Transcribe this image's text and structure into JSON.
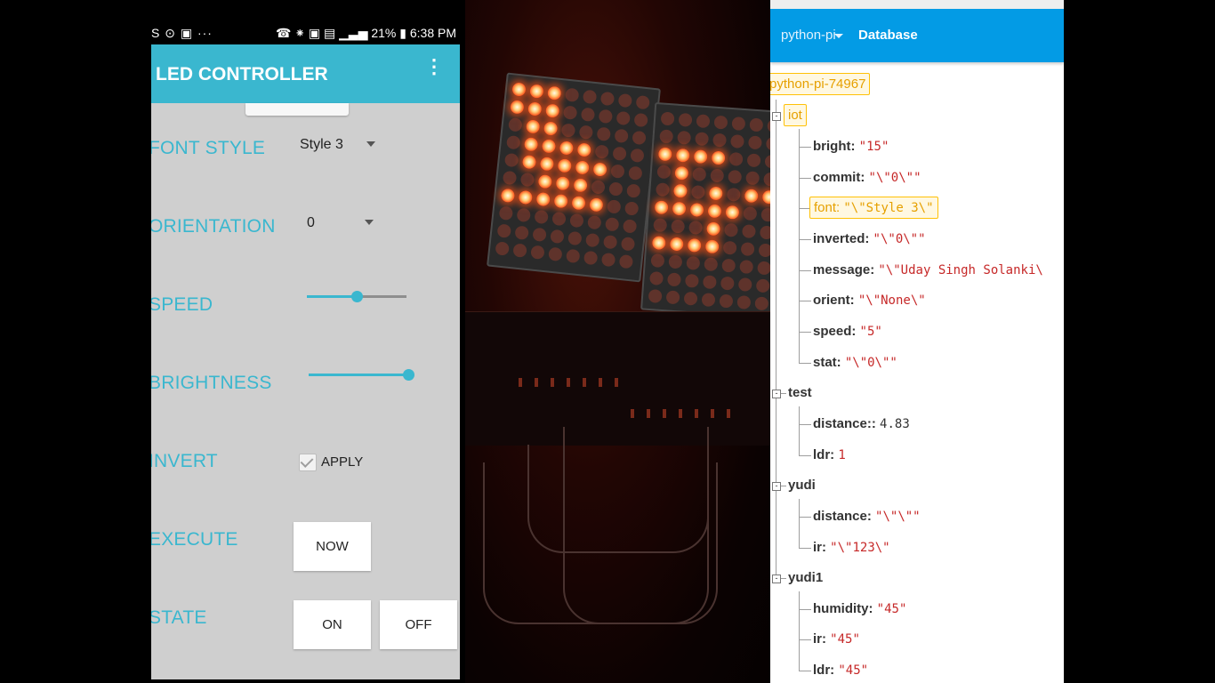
{
  "phone": {
    "status": {
      "left": "S ⊙ ▣  ···",
      "right": "☎ ⁕ ▣ ▤ ▁▃▅ 21% ▮ 6:38 PM"
    },
    "app_title": "LED CONTROLLER",
    "menu_icon": "⋮",
    "rows": {
      "font_label": "FONT STYLE",
      "font_value": "Style 3",
      "orientation_label": "ORIENTATION",
      "orientation_value": "0",
      "speed_label": "SPEED",
      "speed_level": 0.5,
      "brightness_label": "BRIGHTNESS",
      "brightness_level": 1.0,
      "invert_label": "INVERT",
      "apply_label": "APPLY",
      "apply_checked": true,
      "execute_label": "EXECUTE",
      "now_button": "NOW",
      "state_label": "STATE",
      "on_button": "ON",
      "off_button": "OFF"
    },
    "accent": "#3ab7cf"
  },
  "photo": {
    "description_icon": "led-matrix-photo",
    "led_color": "#ff5a20"
  },
  "firebase": {
    "project": "python-pi",
    "tab": "Database",
    "root": "python-pi-74967",
    "iot": {
      "key": "iot",
      "bright_k": "bright:",
      "bright_v": "\"15\"",
      "commit_k": "commit:",
      "commit_v": "\"\\\"0\\\"\"",
      "font_k": "font:",
      "font_v": "\"\\\"Style 3\\\"",
      "inverted_k": "inverted:",
      "inverted_v": "\"\\\"0\\\"\"",
      "message_k": "message:",
      "message_v": "\"\\\"Uday Singh Solanki\\",
      "orient_k": "orient:",
      "orient_v": "\"\\\"None\\\"",
      "speed_k": "speed:",
      "speed_v": "\"5\"",
      "stat_k": "stat:",
      "stat_v": "\"\\\"0\\\"\""
    },
    "test": {
      "key": "test",
      "distance_k": "distance::",
      "distance_v": "4.83",
      "ldr_k": "ldr:",
      "ldr_v": "1"
    },
    "yudi": {
      "key": "yudi",
      "distance_k": "distance:",
      "distance_v": "\"\\\"\\\"\"",
      "ir_k": "ir:",
      "ir_v": "\"\\\"123\\\""
    },
    "yudi1": {
      "key": "yudi1",
      "humidity_k": "humidity:",
      "humidity_v": "\"45\"",
      "ir_k": "ir:",
      "ir_v": "\"45\"",
      "ldr_k": "ldr:",
      "ldr_v": "\"45\""
    },
    "colors": {
      "bar": "#039be5",
      "highlight": "#ffc107",
      "value": "#c62828"
    }
  }
}
